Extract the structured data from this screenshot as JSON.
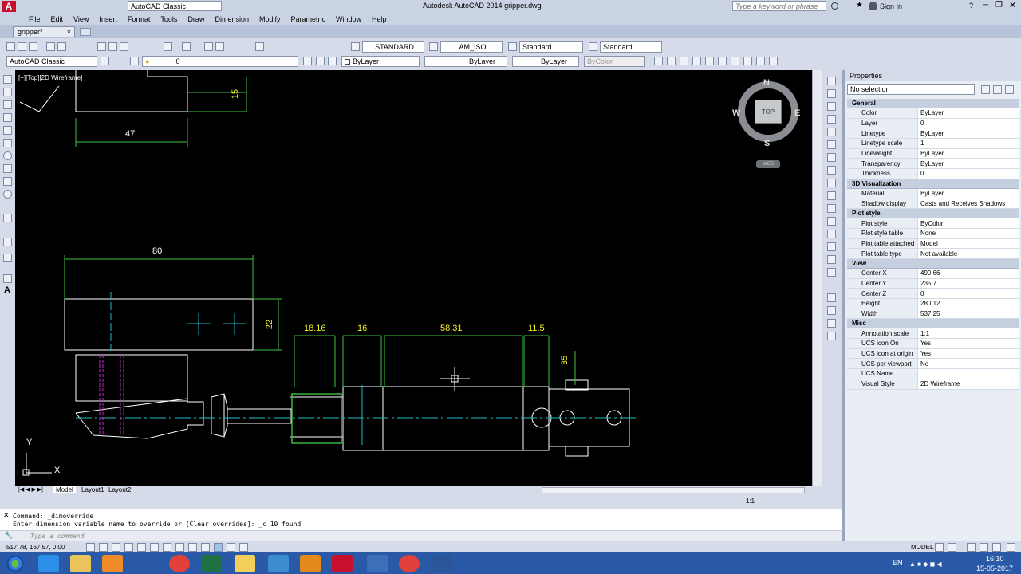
{
  "app": {
    "title": "Autodesk AutoCAD 2014    gripper.dwg",
    "workspace": "AutoCAD Classic",
    "search_placeholder": "Type a keyword or phrase",
    "sign_in": "Sign In",
    "doc_tab": "gripper*"
  },
  "menu": [
    "File",
    "Edit",
    "View",
    "Insert",
    "Format",
    "Tools",
    "Draw",
    "Dimension",
    "Modify",
    "Parametric",
    "Window",
    "Help"
  ],
  "toolbar": {
    "text_style": "STANDARD",
    "dim_style": "AM_ISO",
    "table_style": "Standard",
    "mleader_style": "Standard",
    "workspace_select": "AutoCAD Classic",
    "layer_select": "0",
    "color_select": "ByLayer",
    "linetype_select": "ByLayer",
    "lineweight_select": "ByLayer",
    "plotstyle_select": "ByColor"
  },
  "viewport": {
    "label": "[−][Top][2D Wireframe]",
    "viewcube": {
      "top": "TOP",
      "n": "N",
      "s": "S",
      "e": "E",
      "w": "W",
      "wcs": "WCS"
    },
    "ucs_x": "X",
    "ucs_y": "Y",
    "dims": {
      "d47": "47",
      "d15": "15",
      "d80": "80",
      "d22": "22",
      "d1816": "18.16",
      "d16": "16",
      "d5831": "58.31",
      "d115": "11.5",
      "d35": "35"
    }
  },
  "layout_tabs": [
    "Model",
    "Layout1",
    "Layout2"
  ],
  "annotation_scale": "1:1",
  "properties": {
    "title": "Properties",
    "selection": "No selection",
    "sections": [
      {
        "name": "General",
        "rows": [
          {
            "k": "Color",
            "v": "ByLayer"
          },
          {
            "k": "Layer",
            "v": "0"
          },
          {
            "k": "Linetype",
            "v": "ByLayer"
          },
          {
            "k": "Linetype scale",
            "v": "1"
          },
          {
            "k": "Lineweight",
            "v": "ByLayer"
          },
          {
            "k": "Transparency",
            "v": "ByLayer"
          },
          {
            "k": "Thickness",
            "v": "0"
          }
        ]
      },
      {
        "name": "3D Visualization",
        "rows": [
          {
            "k": "Material",
            "v": "ByLayer"
          },
          {
            "k": "Shadow display",
            "v": "Casts and Receives Shadows"
          }
        ]
      },
      {
        "name": "Plot style",
        "rows": [
          {
            "k": "Plot style",
            "v": "ByColor"
          },
          {
            "k": "Plot style table",
            "v": "None"
          },
          {
            "k": "Plot table attached to",
            "v": "Model"
          },
          {
            "k": "Plot table type",
            "v": "Not available"
          }
        ]
      },
      {
        "name": "View",
        "rows": [
          {
            "k": "Center X",
            "v": "490.66"
          },
          {
            "k": "Center Y",
            "v": "235.7"
          },
          {
            "k": "Center Z",
            "v": "0"
          },
          {
            "k": "Height",
            "v": "280.12"
          },
          {
            "k": "Width",
            "v": "537.25"
          }
        ]
      },
      {
        "name": "Misc",
        "rows": [
          {
            "k": "Annotation scale",
            "v": "1:1"
          },
          {
            "k": "UCS icon On",
            "v": "Yes"
          },
          {
            "k": "UCS icon at origin",
            "v": "Yes"
          },
          {
            "k": "UCS per viewport",
            "v": "No"
          },
          {
            "k": "UCS Name",
            "v": ""
          },
          {
            "k": "Visual Style",
            "v": "2D Wireframe"
          }
        ]
      }
    ]
  },
  "command": {
    "line1": "Command: _dimoverride",
    "line2": "Enter dimension variable name to override or [Clear overrides]: _c 10 found",
    "placeholder": "Type a command"
  },
  "status": {
    "coords": "517.78, 167.57, 0.00",
    "model": "MODEL"
  },
  "taskbar": {
    "lang": "EN",
    "time": "16:10",
    "date": "15-05-2017"
  }
}
